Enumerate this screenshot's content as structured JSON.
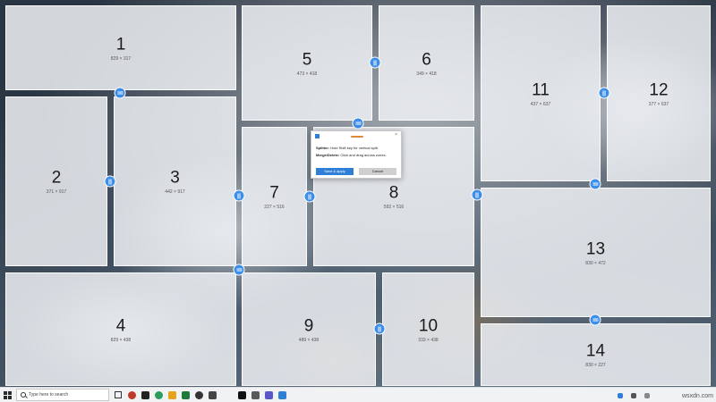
{
  "zones": [
    {
      "id": "1",
      "dims": "829 × 317"
    },
    {
      "id": "2",
      "dims": "371 × 917"
    },
    {
      "id": "3",
      "dims": "442 × 917"
    },
    {
      "id": "4",
      "dims": "829 × 438"
    },
    {
      "id": "5",
      "dims": "473 × 418"
    },
    {
      "id": "6",
      "dims": "349 × 418"
    },
    {
      "id": "7",
      "dims": "227 × 516"
    },
    {
      "id": "8",
      "dims": "592 × 516"
    },
    {
      "id": "9",
      "dims": "489 × 438"
    },
    {
      "id": "10",
      "dims": "333 × 438"
    },
    {
      "id": "11",
      "dims": "437 × 637"
    },
    {
      "id": "12",
      "dims": "377 × 637"
    },
    {
      "id": "13",
      "dims": "830 × 472"
    },
    {
      "id": "14",
      "dims": "830 × 227"
    }
  ],
  "dialog": {
    "splitter_label": "Splitter:",
    "splitter_text": "Hold Shift key for vertical split.",
    "merge_label": "Merge/Delete:",
    "merge_text": "Click and drag across zones.",
    "save_label": "Save & apply",
    "cancel_label": "Cancel",
    "close_glyph": "×"
  },
  "taskbar": {
    "search_placeholder": "Type here to search"
  },
  "watermark": "wsxdn.com",
  "colors": {
    "handle": "#3d8ee8",
    "primary_button": "#2f7fd6",
    "zone_fill": "#eef0f3"
  },
  "icons": {
    "start": "windows-logo-icon",
    "search": "search-icon",
    "handle_vertical": "vertical-splitter-handle-icon",
    "handle_horizontal": "horizontal-splitter-handle-icon"
  }
}
